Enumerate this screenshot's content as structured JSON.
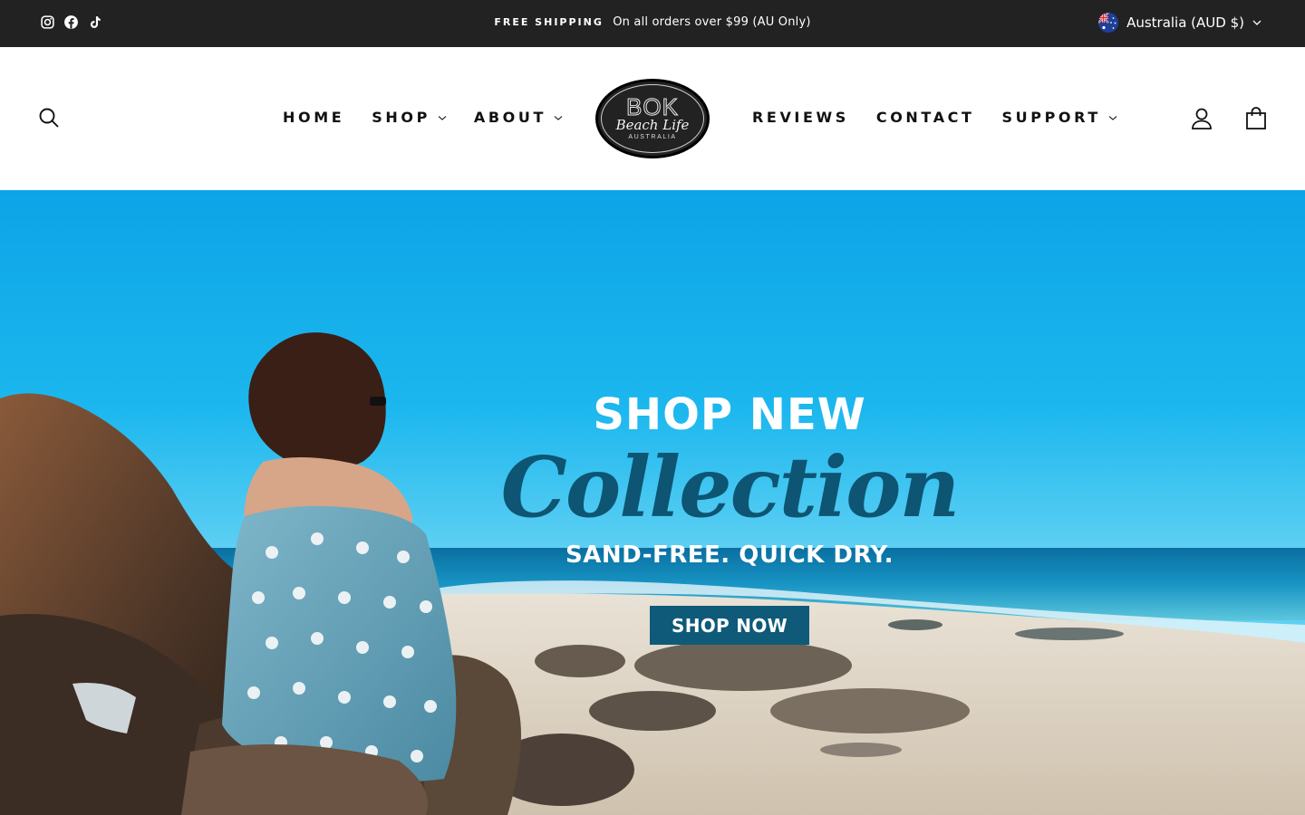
{
  "announcement": {
    "social_icons": [
      "instagram-icon",
      "facebook-icon",
      "tiktok-icon"
    ],
    "strong": "FREE SHIPPING",
    "message": "On all orders over $99 (AU Only)",
    "currency_label": "Australia (AUD $)"
  },
  "header": {
    "nav_left": [
      {
        "label": "HOME",
        "has_dropdown": false
      },
      {
        "label": "SHOP",
        "has_dropdown": true
      },
      {
        "label": "ABOUT",
        "has_dropdown": true
      }
    ],
    "nav_right": [
      {
        "label": "REVIEWS",
        "has_dropdown": false
      },
      {
        "label": "CONTACT",
        "has_dropdown": false
      },
      {
        "label": "SUPPORT",
        "has_dropdown": true
      }
    ],
    "logo": {
      "brand": "BOK",
      "script": "Beach Life",
      "sub": "AUSTRALIA"
    }
  },
  "hero": {
    "headline": "SHOP NEW",
    "script": "Collection",
    "tagline": "SAND-FREE. QUICK DRY.",
    "cta": "SHOP NOW"
  },
  "colors": {
    "announcement_bg": "#222222",
    "cta_bg": "#0e5a78",
    "script_text": "#0d5573",
    "sky": "#0da4e7"
  }
}
